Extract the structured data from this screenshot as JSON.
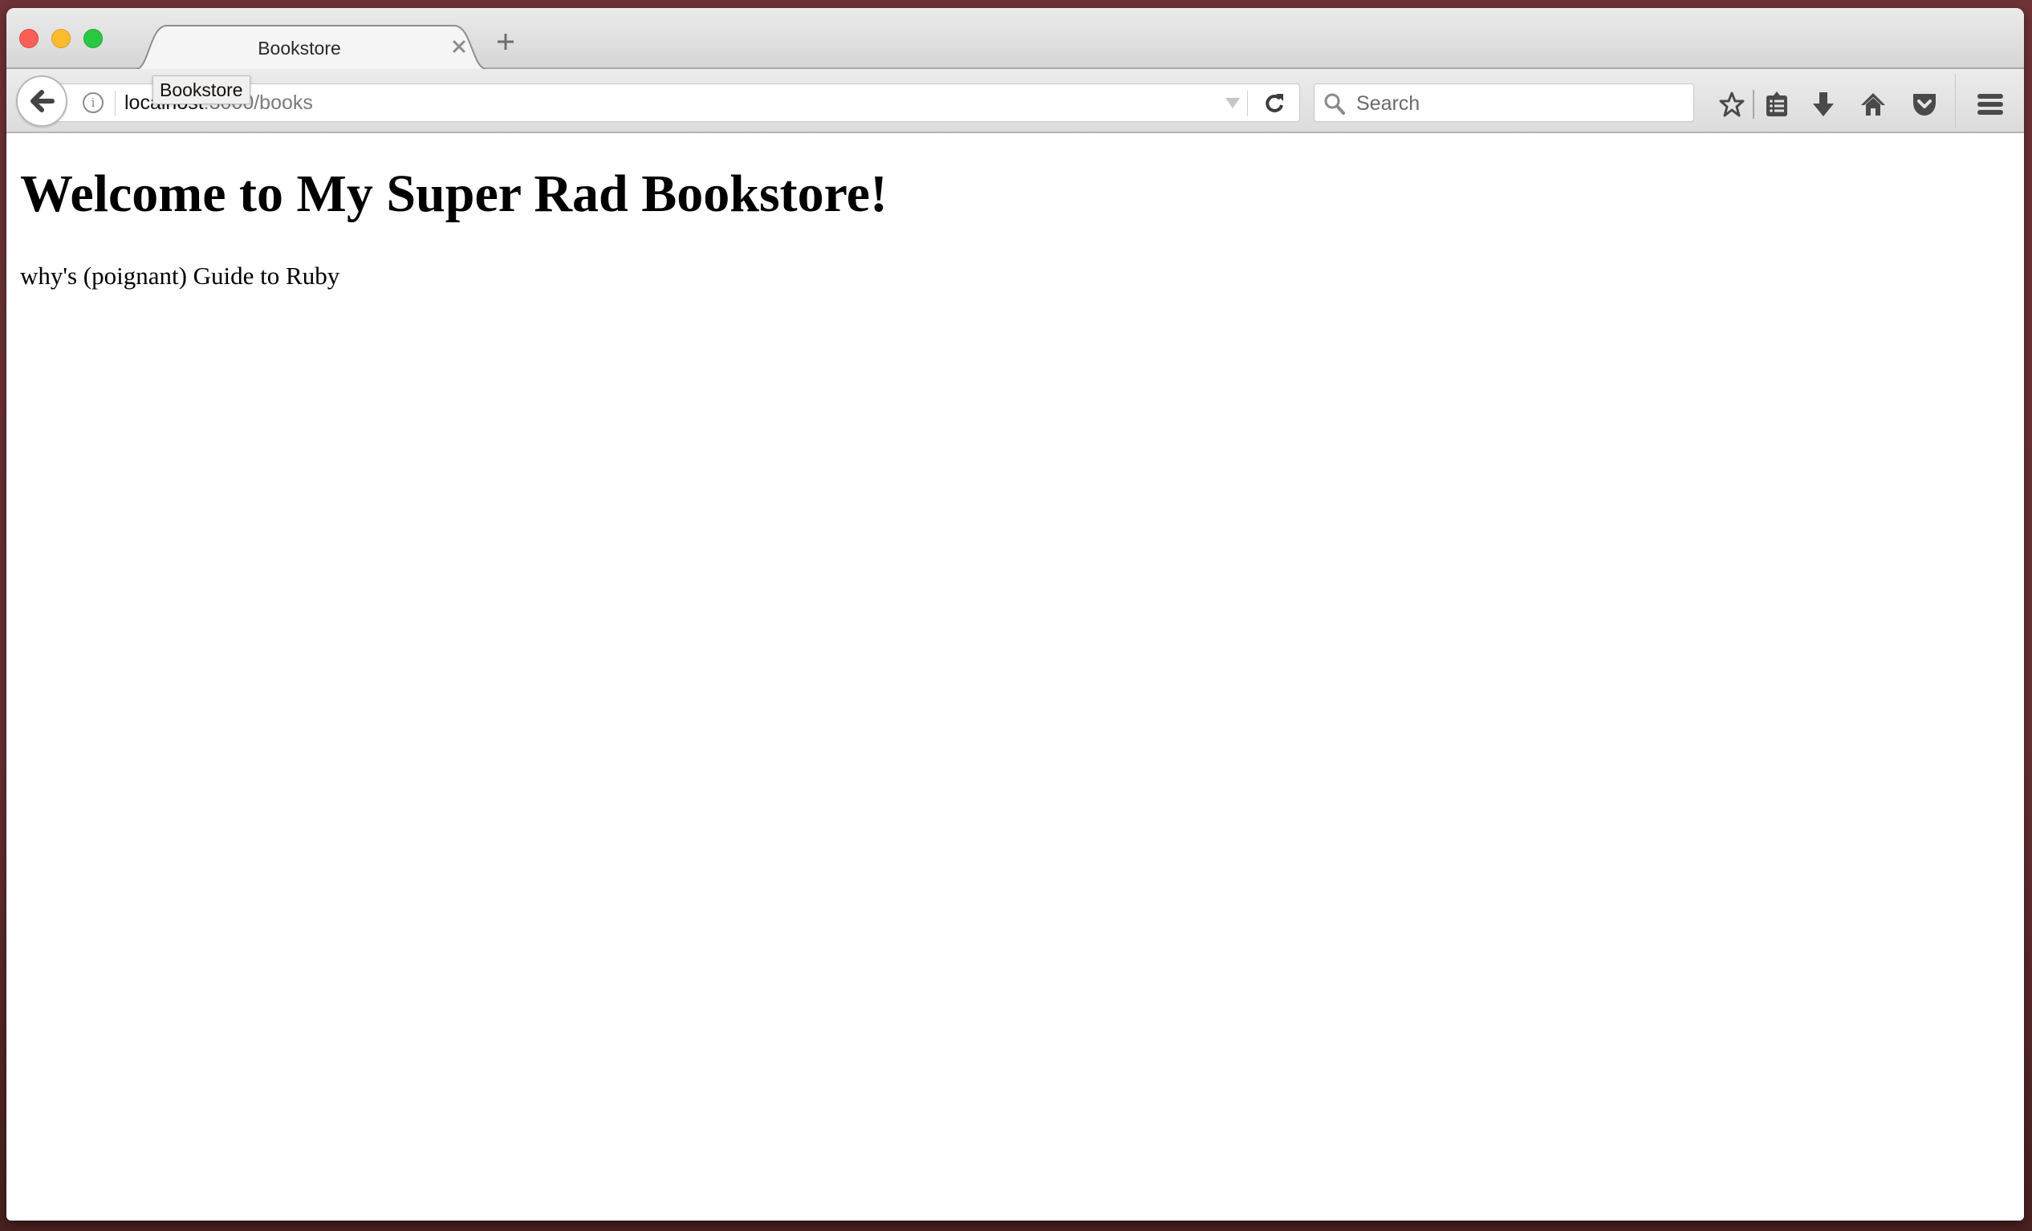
{
  "window": {
    "controls": [
      "close",
      "minimize",
      "maximize"
    ]
  },
  "tabs": [
    {
      "title": "Bookstore",
      "active": true
    }
  ],
  "tab_tooltip": "Bookstore",
  "navbar": {
    "url": {
      "host": "localhost",
      "port_path": ":3000/books"
    },
    "search": {
      "placeholder": "Search",
      "value": ""
    },
    "toolbar_icons": [
      "bookmark-star-icon",
      "reading-list-icon",
      "downloads-icon",
      "home-icon",
      "pocket-icon",
      "menu-icon"
    ]
  },
  "page": {
    "heading": "Welcome to My Super Rad Bookstore!",
    "books": [
      "why's (poignant) Guide to Ruby"
    ]
  },
  "colors": {
    "desktop_bg": "#6f3337",
    "close": "#fc5f57",
    "minimize": "#fdbc2e",
    "maximize": "#28c840",
    "icon_gray": "#4a4a4a"
  }
}
